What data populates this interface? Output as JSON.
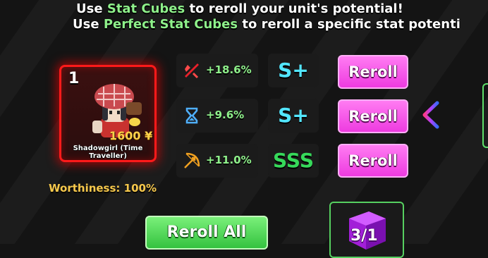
{
  "header": {
    "line1": {
      "prefix": "Use ",
      "highlight": "Stat Cubes",
      "suffix": " to reroll your unit's potential!"
    },
    "line2": {
      "prefix": "Use ",
      "highlight": "Perfect Stat Cubes",
      "suffix": " to reroll a specific stat potenti"
    }
  },
  "unit": {
    "level": "1",
    "price": "1600 ¥",
    "name": "Shadowgirl (Time Traveller)",
    "worthiness": "Worthiness: 100%"
  },
  "stats": [
    {
      "icon": "damage-icon",
      "value": "+18.6%",
      "grade": "S+",
      "reroll_label": "Reroll"
    },
    {
      "icon": "hourglass-icon",
      "value": "+9.6%",
      "grade": "S+",
      "reroll_label": "Reroll"
    },
    {
      "icon": "range-bow-icon",
      "value": "+11.0%",
      "grade": "SSS",
      "reroll_label": "Reroll"
    }
  ],
  "reroll_all_label": "Reroll All",
  "cube": {
    "icon": "stat-cube-icon",
    "count": "3/1"
  },
  "colors": {
    "highlight_green": "#8ef08a",
    "reroll_pink": "#ee3be0",
    "card_red": "#ff1a1a",
    "grade_splus": "#52e6ff",
    "grade_sss": "#36d95a",
    "worthiness_gold": "#f6c84c"
  }
}
